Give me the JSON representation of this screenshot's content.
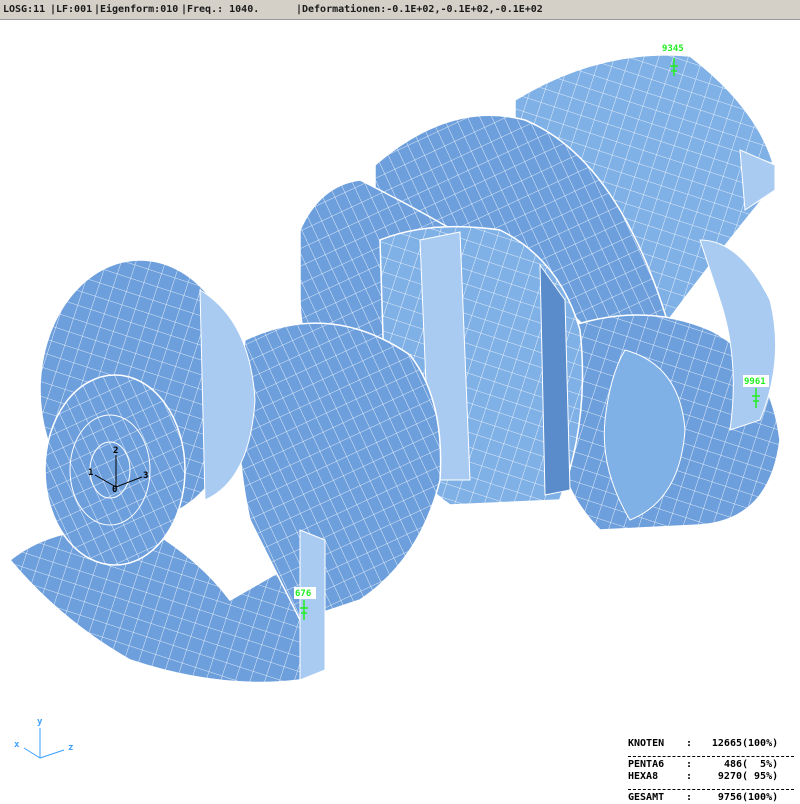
{
  "header": {
    "losg": "LOSG:11",
    "lf": "LF:001",
    "eigenform": "Eigenform:010",
    "freq": "Freq.: 1040.",
    "deformationen": "Deformationen:-0.1E+02,-0.1E+02,-0.1E+02"
  },
  "colors": {
    "mesh_fill": "#6d9fdc",
    "mesh_light": "#a9cbf2",
    "mesh_edge": "#ffffff",
    "node_marker": "#22ee22",
    "view_triad": "#3aa0ff"
  },
  "nodes": [
    {
      "id": "9345"
    },
    {
      "id": "9961"
    },
    {
      "id": "676"
    }
  ],
  "local_triad": {
    "axis1": "1",
    "axis2": "2",
    "axis3": "3",
    "origin": "0"
  },
  "view_triad": {
    "x": "x",
    "y": "y",
    "z": "z"
  },
  "statistics": {
    "knoten": {
      "label": "KNOTEN",
      "value": "12665",
      "percent": "(100%)"
    },
    "penta6": {
      "label": "PENTA6",
      "value": "486",
      "percent": "(  5%)"
    },
    "hexa8": {
      "label": "HEXA8",
      "value": "9270",
      "percent": "( 95%)"
    },
    "gesamt": {
      "label": "GESAMT",
      "value": "9756",
      "percent": "(100%)"
    }
  }
}
